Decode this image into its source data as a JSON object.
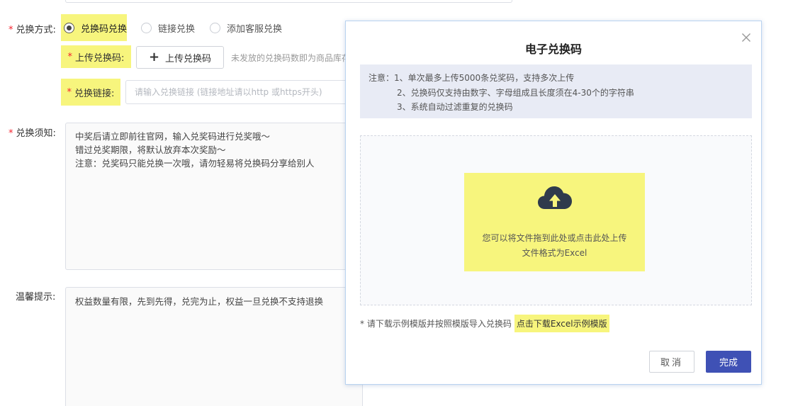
{
  "form": {
    "required_mark": "*",
    "method": {
      "label": "兑换方式:",
      "options": [
        {
          "label": "兑换码兑换",
          "selected": true
        },
        {
          "label": "链接兑换",
          "selected": false
        },
        {
          "label": "添加客服兑换",
          "selected": false
        }
      ]
    },
    "upload": {
      "label": "上传兑换码:",
      "button_label": "上传兑换码",
      "hint": "未发放的兑换码数即为商品库存"
    },
    "link": {
      "label": "兑换链接:",
      "placeholder": "请输入兑换链接 (链接地址请以http 或https开头)"
    },
    "notes": {
      "label": "兑换须知:",
      "lines": [
        "中奖后请立即前往官网，输入兑奖码进行兑奖哦～",
        "错过兑奖期限，将默认放弃本次奖励～",
        "注意：兑奖码只能兑换一次哦，请勿轻易将兑换码分享给别人"
      ]
    },
    "tips": {
      "label": "温馨提示:",
      "text": "权益数量有限，先到先得，兑完为止，权益一旦兑换不支持退换"
    }
  },
  "dialog": {
    "title": "电子兑换码",
    "notice": {
      "prefix": "注意：",
      "items": [
        "1、单次最多上传5000条兑奖码，支持多次上传",
        "2、兑换码仅支持由数字、字母组成且长度须在4-30个的字符串",
        "3、系统自动过滤重复的兑换码"
      ]
    },
    "dropzone": {
      "line1": "您可以将文件拖到此处或点击此处上传",
      "line2": "文件格式为Excel"
    },
    "footnote": "* 请下载示例模版并按照模版导入兑换码",
    "download_link": "点击下载Excel示例模版",
    "cancel_label": "取消",
    "done_label": "完成"
  },
  "colors": {
    "accent": "#3f51b5",
    "highlight": "#f7f57d",
    "required": "#f5222d",
    "icon": "#2f3b4c"
  }
}
